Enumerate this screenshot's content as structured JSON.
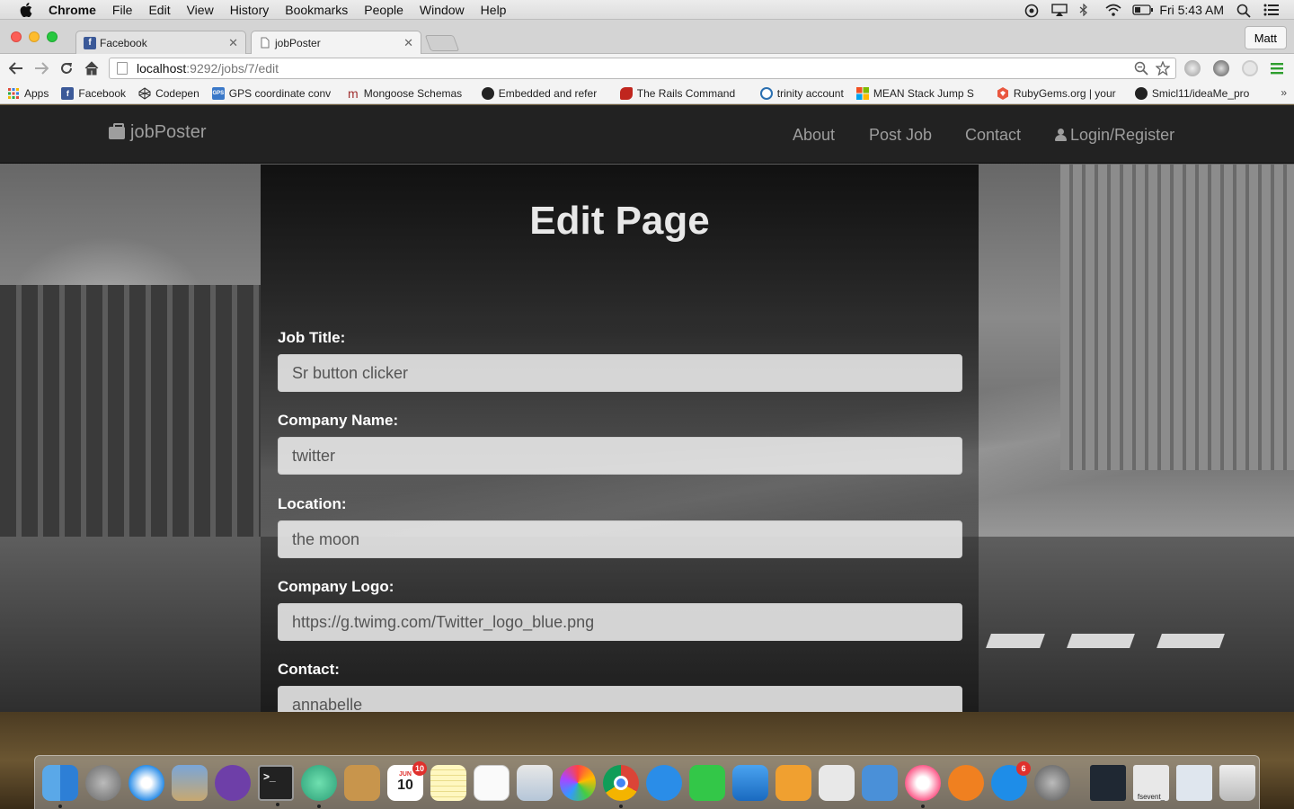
{
  "menubar": {
    "app": "Chrome",
    "items": [
      "File",
      "Edit",
      "View",
      "History",
      "Bookmarks",
      "People",
      "Window",
      "Help"
    ],
    "clock": "Fri 5:43 AM"
  },
  "tabs": [
    {
      "title": "Facebook",
      "favicon": "facebook-icon"
    },
    {
      "title": "jobPoster",
      "favicon": "page-icon"
    }
  ],
  "profile": "Matt",
  "address": {
    "host": "localhost",
    "path": ":9292/jobs/7/edit"
  },
  "bookmarks": [
    {
      "label": "Apps",
      "icon": "apps-grid-icon",
      "color": "#e04b3a"
    },
    {
      "label": "Facebook",
      "icon": "facebook-icon",
      "color": "#3b5998"
    },
    {
      "label": "Codepen",
      "icon": "codepen-icon",
      "color": "#333333"
    },
    {
      "label": "GPS coordinate conv",
      "icon": "gps-icon",
      "color": "#3a78c8"
    },
    {
      "label": "Mongoose Schemas",
      "icon": "mongoose-icon",
      "color": "#a03030"
    },
    {
      "label": "Embedded and refer",
      "icon": "github-icon",
      "color": "#222222"
    },
    {
      "label": "The Rails Command",
      "icon": "rails-icon",
      "color": "#c0261e"
    },
    {
      "label": "trinity account",
      "icon": "trinity-icon",
      "color": "#2a6fb0"
    },
    {
      "label": "MEAN Stack Jump S",
      "icon": "windows-icon",
      "color": "#f25022"
    },
    {
      "label": "RubyGems.org | your",
      "icon": "rubygems-icon",
      "color": "#e9573f"
    },
    {
      "label": "Smicl11/ideaMe_pro",
      "icon": "github-icon",
      "color": "#222222"
    }
  ],
  "site": {
    "brand": "jobPoster",
    "nav": [
      {
        "label": "About"
      },
      {
        "label": "Post Job"
      },
      {
        "label": "Contact"
      },
      {
        "label": "Login/Register"
      }
    ]
  },
  "form": {
    "heading": "Edit Page",
    "fields": [
      {
        "label": "Job Title:",
        "value": "Sr button clicker"
      },
      {
        "label": "Company Name:",
        "value": "twitter"
      },
      {
        "label": "Location:",
        "value": "the moon"
      },
      {
        "label": "Company Logo:",
        "value": "https://g.twimg.com/Twitter_logo_blue.png"
      },
      {
        "label": "Contact:",
        "value": "annabelle"
      }
    ]
  },
  "dock": {
    "calendar_month": "JUN",
    "calendar_day": "10",
    "calendar_badge": "10",
    "appstore_badge": "6",
    "terminal_label": "fsevent_"
  }
}
